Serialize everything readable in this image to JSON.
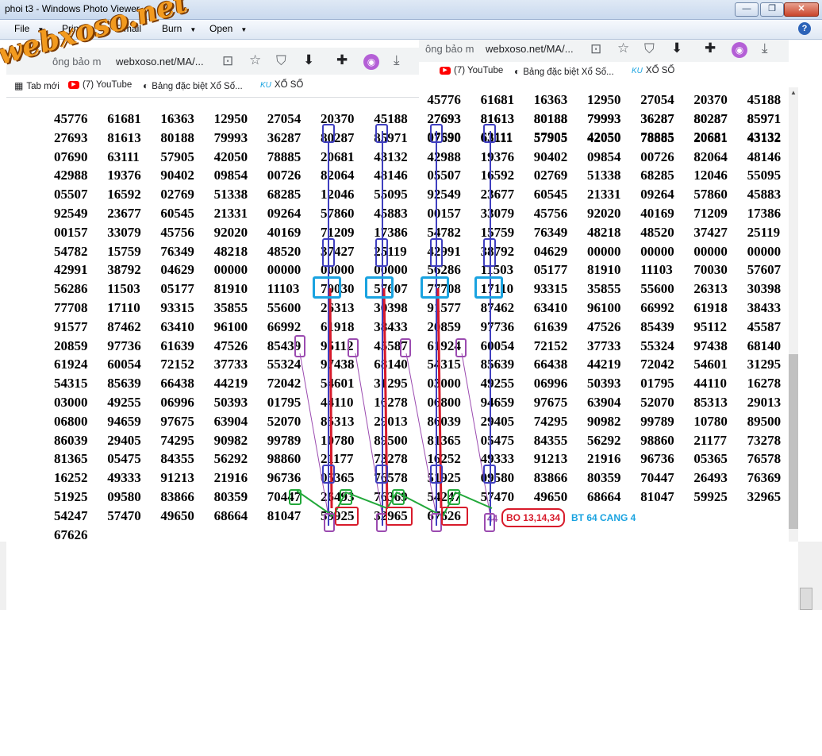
{
  "window": {
    "title": "phoi t3 - Windows Photo Viewer",
    "minimize": "—",
    "restore": "❐",
    "close": "✕"
  },
  "menu": {
    "items": [
      "File",
      "Print",
      "E-mail",
      "Burn",
      "Open"
    ],
    "help": "?"
  },
  "watermark": "webxoso.net",
  "browser_back": {
    "tab_tail": "ông bảo m",
    "url": "webxoso.net/MA/...",
    "bookmarks": [
      "(7) YouTube",
      "Bảng đặc biệt Xổ Số...",
      "XỔ SỐ"
    ],
    "bm_icons": [
      "yt",
      "◐",
      "KU"
    ]
  },
  "browser_front": {
    "tab_tail": "ông bảo m",
    "url": "webxoso.net/MA/...",
    "bookmarks": [
      "Tab mới",
      "(7) YouTube",
      "Bảng đặc biệt Xổ Số...",
      "XỔ SỐ"
    ],
    "bm_icons": [
      "▦",
      "yt",
      "◐",
      "KU"
    ]
  },
  "toolbar_icons": {
    "share": "⊡",
    "star": "☆",
    "shield": "⛉",
    "save": "⬇",
    "puzzle": "✚",
    "avatar": "◉",
    "download": "⤓"
  },
  "rows_top": [
    [
      "45776",
      "61681",
      "16363",
      "12950",
      "27054",
      "20370",
      "45188"
    ],
    [
      "27693",
      "81613",
      "80188",
      "79993",
      "36287",
      "80287",
      "85971"
    ],
    [
      "07690",
      "63111",
      "57905",
      "42050",
      "78885",
      "20681",
      "43132"
    ]
  ],
  "rows_main": [
    [
      "45776",
      "61681",
      "16363",
      "12950",
      "27054",
      "20370",
      "45188",
      "27693",
      "81613",
      "80188",
      "79993",
      "36287",
      "80287",
      "85971"
    ],
    [
      "27693",
      "81613",
      "80188",
      "79993",
      "36287",
      "80287",
      "85971",
      "07690",
      "63111",
      "57905",
      "42050",
      "78885",
      "20681",
      "43132"
    ],
    [
      "07690",
      "63111",
      "57905",
      "42050",
      "78885",
      "20681",
      "43132",
      "42988",
      "19376",
      "90402",
      "09854",
      "00726",
      "82064",
      "48146"
    ],
    [
      "42988",
      "19376",
      "90402",
      "09854",
      "00726",
      "82064",
      "48146",
      "05507",
      "16592",
      "02769",
      "51338",
      "68285",
      "12046",
      "55095"
    ],
    [
      "05507",
      "16592",
      "02769",
      "51338",
      "68285",
      "12046",
      "55095",
      "92549",
      "23677",
      "60545",
      "21331",
      "09264",
      "57860",
      "45883"
    ],
    [
      "92549",
      "23677",
      "60545",
      "21331",
      "09264",
      "57860",
      "45883",
      "00157",
      "33079",
      "45756",
      "92020",
      "40169",
      "71209",
      "17386"
    ],
    [
      "00157",
      "33079",
      "45756",
      "92020",
      "40169",
      "71209",
      "17386",
      "54782",
      "15759",
      "76349",
      "48218",
      "48520",
      "37427",
      "25119"
    ],
    [
      "54782",
      "15759",
      "76349",
      "48218",
      "48520",
      "37427",
      "25119",
      "42991",
      "38792",
      "04629",
      "00000",
      "00000",
      "00000",
      "00000"
    ],
    [
      "42991",
      "38792",
      "04629",
      "00000",
      "00000",
      "00000",
      "00000",
      "56286",
      "11503",
      "05177",
      "81910",
      "11103",
      "70030",
      "57607"
    ],
    [
      "56286",
      "11503",
      "05177",
      "81910",
      "11103",
      "70030",
      "57607",
      "77708",
      "17110",
      "93315",
      "35855",
      "55600",
      "26313",
      "30398"
    ],
    [
      "77708",
      "17110",
      "93315",
      "35855",
      "55600",
      "26313",
      "30398",
      "91577",
      "87462",
      "63410",
      "96100",
      "66992",
      "61918",
      "38433"
    ],
    [
      "91577",
      "87462",
      "63410",
      "96100",
      "66992",
      "61918",
      "38433",
      "20859",
      "97736",
      "61639",
      "47526",
      "85439",
      "95112",
      "45587"
    ],
    [
      "20859",
      "97736",
      "61639",
      "47526",
      "85439",
      "95112",
      "45587",
      "61924",
      "60054",
      "72152",
      "37733",
      "55324",
      "97438",
      "68140"
    ],
    [
      "61924",
      "60054",
      "72152",
      "37733",
      "55324",
      "97438",
      "68140",
      "54315",
      "85639",
      "66438",
      "44219",
      "72042",
      "54601",
      "31295"
    ],
    [
      "54315",
      "85639",
      "66438",
      "44219",
      "72042",
      "54601",
      "31295",
      "03000",
      "49255",
      "06996",
      "50393",
      "01795",
      "44110",
      "16278"
    ],
    [
      "03000",
      "49255",
      "06996",
      "50393",
      "01795",
      "44110",
      "16278",
      "06800",
      "94659",
      "97675",
      "63904",
      "52070",
      "85313",
      "29013"
    ],
    [
      "06800",
      "94659",
      "97675",
      "63904",
      "52070",
      "85313",
      "29013",
      "86039",
      "29405",
      "74295",
      "90982",
      "99789",
      "10780",
      "89500"
    ],
    [
      "86039",
      "29405",
      "74295",
      "90982",
      "99789",
      "10780",
      "89500",
      "81365",
      "05475",
      "84355",
      "56292",
      "98860",
      "21177",
      "73278"
    ],
    [
      "81365",
      "05475",
      "84355",
      "56292",
      "98860",
      "21177",
      "73278",
      "16252",
      "49333",
      "91213",
      "21916",
      "96736",
      "05365",
      "76578"
    ],
    [
      "16252",
      "49333",
      "91213",
      "21916",
      "96736",
      "05365",
      "76578",
      "51925",
      "09580",
      "83866",
      "80359",
      "70447",
      "26493",
      "76369"
    ],
    [
      "51925",
      "09580",
      "83866",
      "80359",
      "70447",
      "26493",
      "76369",
      "54247",
      "57470",
      "49650",
      "68664",
      "81047",
      "59925",
      "32965"
    ],
    [
      "54247",
      "57470",
      "49650",
      "68664",
      "81047",
      "59925",
      "32965",
      "67626",
      "44"
    ]
  ],
  "last_number": "67626",
  "callout_text": "BO 13,14,34",
  "note_text": "BT 64 CANG 4",
  "colors": {
    "blue": "#3f3fbf",
    "cyan": "#1aa3e0",
    "purple": "#9b4bb0",
    "red": "#d81b2b",
    "green": "#22a83a",
    "watermark": "#f29a1f"
  }
}
